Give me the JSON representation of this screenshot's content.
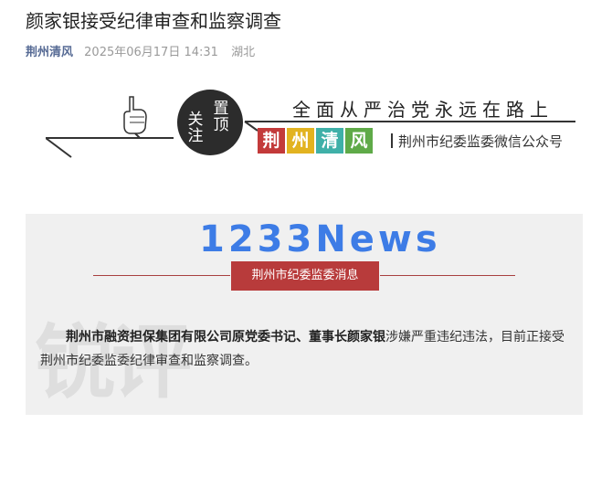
{
  "article": {
    "title": "颜家银接受纪律审查和监察调查",
    "account": "荆州清风",
    "date": "2025年06月17日 14:31",
    "location": "湖北"
  },
  "banner": {
    "follow_top": "置顶",
    "follow": "关注",
    "slogan": "全面从严治党永远在路上",
    "brand_chars": [
      "荆",
      "州",
      "清",
      "风"
    ],
    "brand_colors": [
      "#c33a3a",
      "#e2b320",
      "#3fb0a8",
      "#5faa48"
    ],
    "public_account": "荆州市纪委监委微信公众号",
    "icons": [
      "hand-pointing-icon"
    ]
  },
  "card": {
    "logo": "1233News",
    "badge": "荆州市纪委监委消息",
    "watermark": "锐评",
    "paragraph_bold": "荆州市融资担保集团有限公司原党委书记、董事长颜家银",
    "paragraph_rest": "涉嫌严重违纪违法，目前正接受荆州市纪委监委纪律审查和监察调查。"
  }
}
